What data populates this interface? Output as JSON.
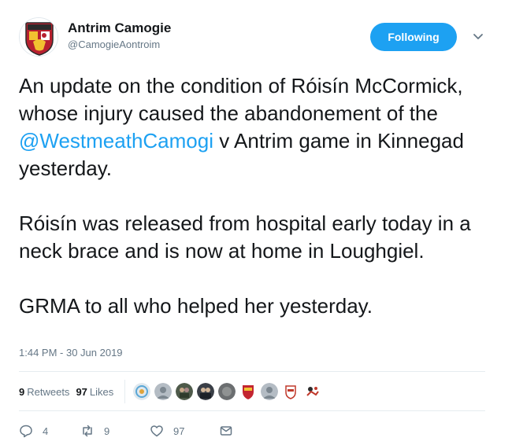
{
  "account": {
    "display_name": "Antrim Camogie",
    "handle": "@CamogieAontroim",
    "avatar_label": "ANTRIM"
  },
  "header": {
    "follow_label": "Following"
  },
  "tweet": {
    "text_before": "An update on the condition of Róisín McCormick, whose injury caused the abandonement of the ",
    "mention": "@WestmeathCamogi",
    "text_after": " v Antrim game in Kinnegad yesterday.\n\nRóisín was released from hospital early today in a neck brace and is now at home in Loughgiel.\n\nGRMA to all who helped her yesterday.",
    "timestamp": "1:44 PM - 30 Jun 2019"
  },
  "stats": {
    "retweets_count": "9",
    "retweets_label": "Retweets",
    "likes_count": "97",
    "likes_label": "Likes"
  },
  "actions": {
    "replies": "4",
    "retweets": "9",
    "likes": "97"
  },
  "colors": {
    "accent": "#1da1f2",
    "text": "#14171a",
    "secondary": "#657786"
  }
}
